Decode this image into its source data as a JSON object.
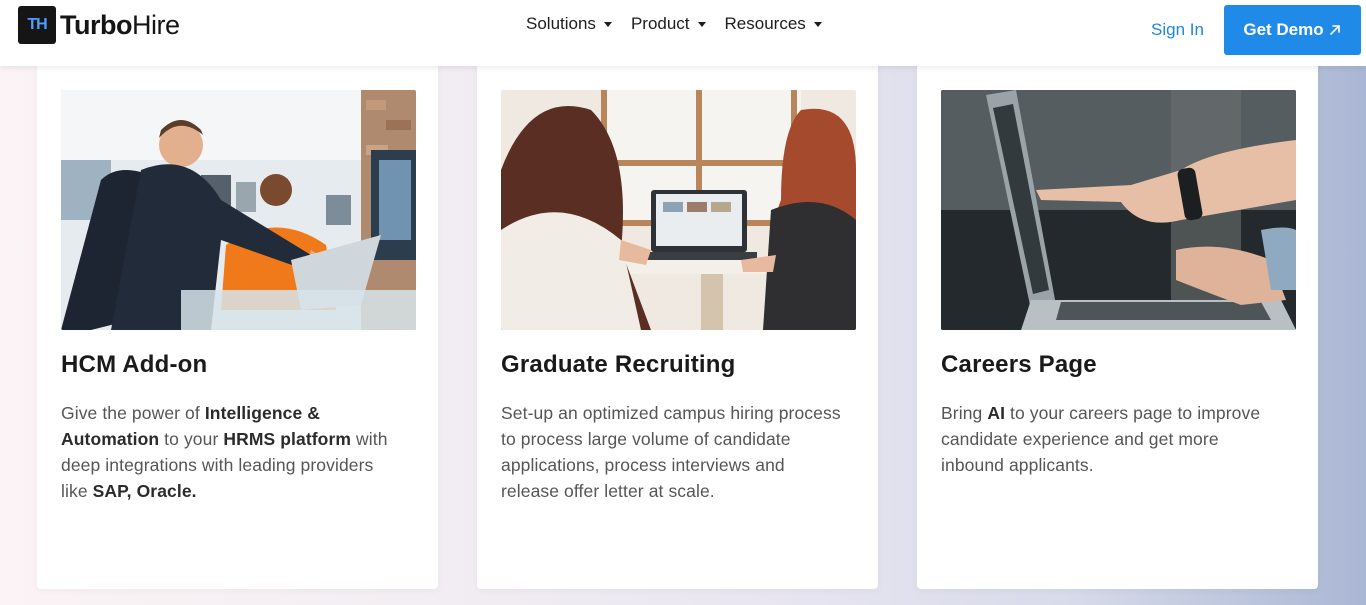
{
  "header": {
    "logo_mark": "TH",
    "logo_turbo": "Turbo",
    "logo_hire": "Hire",
    "nav": [
      {
        "label": "Solutions"
      },
      {
        "label": "Product"
      },
      {
        "label": "Resources"
      }
    ],
    "sign_in": "Sign In",
    "get_demo": "Get Demo",
    "accent_color": "#1f8ae8"
  },
  "cards": [
    {
      "title": "HCM Add-on",
      "image_icon": "office-handshake-photo",
      "desc": [
        {
          "t": "Give the power of ",
          "b": false
        },
        {
          "t": "Intelligence & Automation",
          "b": true
        },
        {
          "t": " to your ",
          "b": false
        },
        {
          "t": "HRMS platform",
          "b": true
        },
        {
          "t": " with deep integrations with leading providers like ",
          "b": false
        },
        {
          "t": "SAP, Oracle.",
          "b": true
        }
      ]
    },
    {
      "title": "Graduate Recruiting",
      "image_icon": "campus-laptop-photo",
      "desc": [
        {
          "t": "Set-up an optimized campus hiring process to process large volume of candidate applications, process interviews and release offer letter at scale.",
          "b": false
        }
      ]
    },
    {
      "title": "Careers Page",
      "image_icon": "laptop-pointing-photo",
      "desc": [
        {
          "t": "Bring ",
          "b": false
        },
        {
          "t": "AI",
          "b": true
        },
        {
          "t": " to your careers page to improve candidate experience and get more inbound applicants.",
          "b": false
        }
      ]
    }
  ]
}
